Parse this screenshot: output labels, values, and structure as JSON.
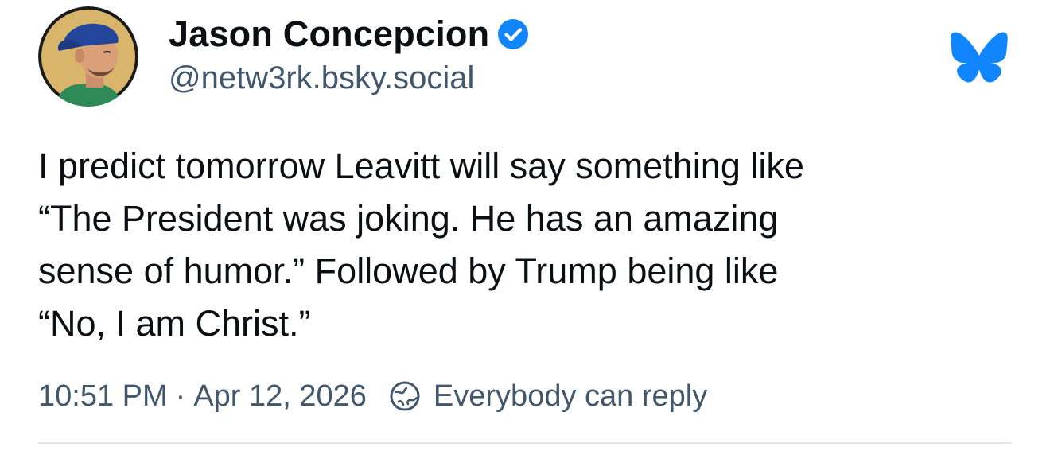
{
  "post": {
    "author": {
      "display_name": "Jason Concepcion",
      "handle": "@netw3rk.bsky.social",
      "verified": true,
      "avatar": "profile-photo-man-in-blue-cap"
    },
    "text_lines": [
      "I predict tomorrow Leavitt will say something like",
      "“The President was joking. He has an amazing",
      "sense of humor.” Followed by Trump being like",
      "“No, I am Christ.”"
    ],
    "time": "10:51 PM",
    "separator": "·",
    "date": "Apr 12, 2026",
    "reply_setting": "Everybody can reply"
  },
  "icons": {
    "verified": "verified-check-icon",
    "logo": "bluesky-butterfly-icon",
    "reply_setting": "globe-icon"
  },
  "colors": {
    "brand_blue": "#1185fe",
    "text_primary": "#0b0f14",
    "text_secondary": "#42576c",
    "divider": "#e3e8ee"
  }
}
